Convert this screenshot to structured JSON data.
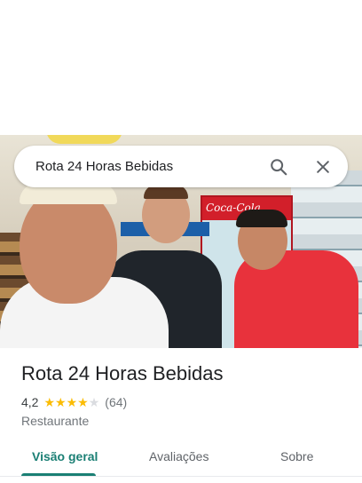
{
  "search": {
    "query": "Rota 24 Horas Bebidas",
    "search_icon": "search-icon",
    "close_icon": "close-icon"
  },
  "photo": {
    "fridge_brand": "Coca-Cola"
  },
  "place": {
    "name": "Rota 24 Horas Bebidas",
    "rating": "4,2",
    "rating_value": 4.2,
    "stars_max": 5,
    "review_count": "(64)",
    "category": "Restaurante"
  },
  "tabs": [
    {
      "label": "Visão geral",
      "active": true
    },
    {
      "label": "Avaliações",
      "active": false
    },
    {
      "label": "Sobre",
      "active": false
    }
  ],
  "colors": {
    "accent": "#1a7f74",
    "star": "#fbbc04",
    "star_empty": "#dadce0",
    "text": "#202124",
    "muted": "#70757a"
  }
}
